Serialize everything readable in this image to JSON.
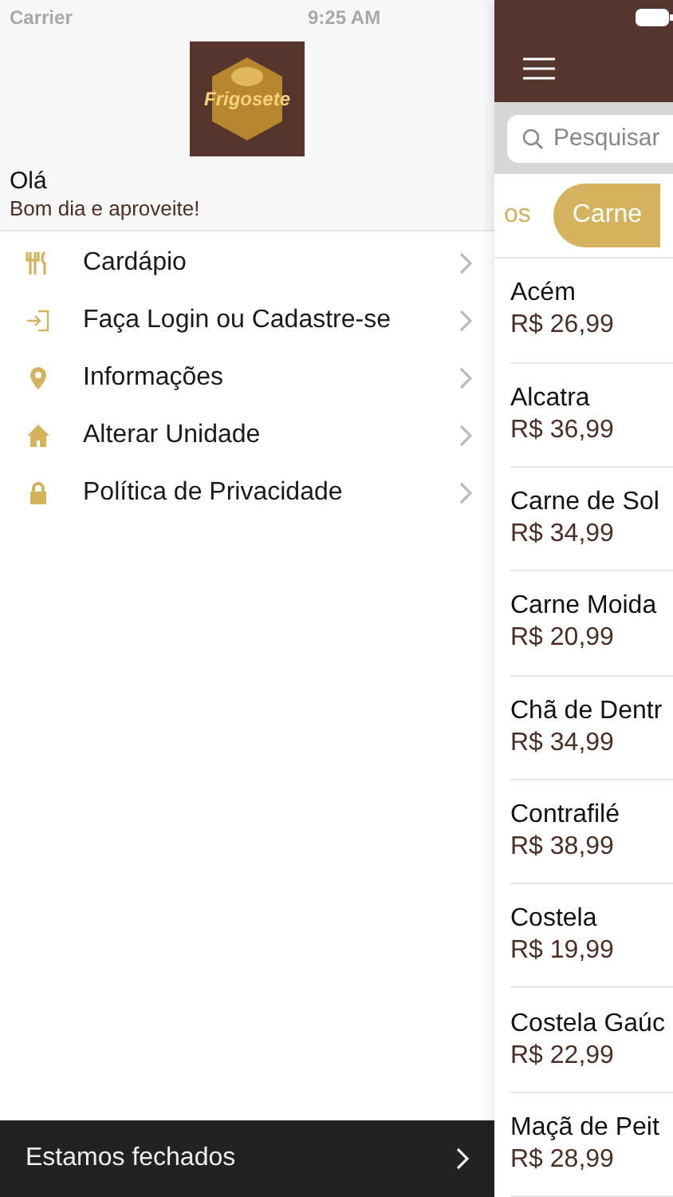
{
  "status_bar": {
    "carrier": "Carrier",
    "time": "9:25 AM"
  },
  "drawer": {
    "logo_text": "Frigosete",
    "greeting": "Olá",
    "subtitle": "Bom dia e aproveite!",
    "menu": [
      {
        "kind": "cutlery",
        "label": "Cardápio"
      },
      {
        "kind": "login",
        "label": "Faça Login ou Cadastre-se"
      },
      {
        "kind": "pin",
        "label": "Informações"
      },
      {
        "kind": "home",
        "label": "Alterar Unidade"
      },
      {
        "kind": "lock",
        "label": "Política de Privacidade"
      }
    ],
    "footer": "Estamos fechados"
  },
  "main": {
    "search": {
      "placeholder": "Pesquisar"
    },
    "categories": [
      {
        "label": "os",
        "selected": false
      },
      {
        "label": "Carne",
        "selected": true
      }
    ],
    "products": [
      {
        "name": "Acém",
        "price": "R$ 26,99"
      },
      {
        "name": "Alcatra",
        "price": "R$ 36,99"
      },
      {
        "name": "Carne de Sol",
        "price": "R$ 34,99"
      },
      {
        "name": "Carne Moida",
        "price": "R$ 20,99"
      },
      {
        "name": "Chã de Dentr",
        "price": "R$ 34,99"
      },
      {
        "name": "Contrafilé",
        "price": "R$ 38,99"
      },
      {
        "name": "Costela",
        "price": "R$ 19,99"
      },
      {
        "name": "Costela Gaúc",
        "price": "R$ 22,99"
      },
      {
        "name": "Maçã de Peit",
        "price": "R$ 28,99"
      }
    ]
  }
}
